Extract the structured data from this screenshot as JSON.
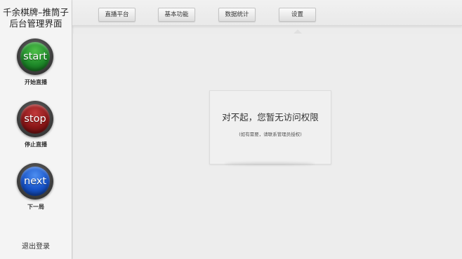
{
  "app": {
    "title_line1": "千余棋牌–推筒子",
    "title_line2": "后台管理界面"
  },
  "controls": [
    {
      "button_text": "start",
      "label": "开始直播",
      "color": "#1f8a2a"
    },
    {
      "button_text": "stop",
      "label": "停止直播",
      "color": "#8b1718"
    },
    {
      "button_text": "next",
      "label": "下一局",
      "color": "#1753c8"
    }
  ],
  "sidebar": {
    "logout_label": "退出登录"
  },
  "tabs": [
    {
      "label": "直播平台",
      "active": false
    },
    {
      "label": "基本功能",
      "active": false
    },
    {
      "label": "数据统计",
      "active": false
    },
    {
      "label": "设置",
      "active": true
    }
  ],
  "message": {
    "title": "对不起，您暂无访问权限",
    "subtitle": "(如有需要，请联系管理员授权)"
  }
}
